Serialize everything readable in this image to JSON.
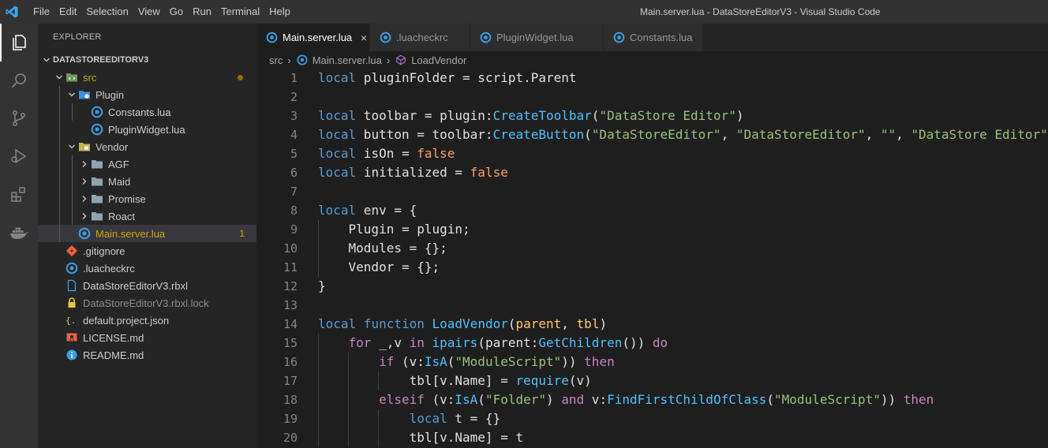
{
  "window": {
    "title": "Main.server.lua - DataStoreEditorV3 - Visual Studio Code"
  },
  "menu": [
    "File",
    "Edit",
    "Selection",
    "View",
    "Go",
    "Run",
    "Terminal",
    "Help"
  ],
  "activity_bar": [
    "explorer-icon",
    "search-icon",
    "source-control-icon",
    "run-debug-icon",
    "extensions-icon",
    "docker-icon"
  ],
  "sidebar": {
    "title": "EXPLORER",
    "section": "DATASTOREEDITORV3",
    "tree": [
      {
        "label": "src",
        "depth": 0,
        "kind": "folder-src",
        "expanded": true,
        "status": "modified"
      },
      {
        "label": "Plugin",
        "depth": 1,
        "kind": "folder-plugin",
        "expanded": true
      },
      {
        "label": "Constants.lua",
        "depth": 2,
        "kind": "lua"
      },
      {
        "label": "PluginWidget.lua",
        "depth": 2,
        "kind": "lua"
      },
      {
        "label": "Vendor",
        "depth": 1,
        "kind": "folder-vendor",
        "expanded": true
      },
      {
        "label": "AGF",
        "depth": 2,
        "kind": "folder",
        "expanded": false
      },
      {
        "label": "Maid",
        "depth": 2,
        "kind": "folder",
        "expanded": false
      },
      {
        "label": "Promise",
        "depth": 2,
        "kind": "folder",
        "expanded": false
      },
      {
        "label": "Roact",
        "depth": 2,
        "kind": "folder",
        "expanded": false
      },
      {
        "label": "Main.server.lua",
        "depth": 1,
        "kind": "lua",
        "selected": true,
        "status": "warning",
        "badge": "1"
      },
      {
        "label": ".gitignore",
        "depth": 0,
        "kind": "git"
      },
      {
        "label": ".luacheckrc",
        "depth": 0,
        "kind": "lua"
      },
      {
        "label": "DataStoreEditorV3.rbxl",
        "depth": 0,
        "kind": "file"
      },
      {
        "label": "DataStoreEditorV3.rbxl.lock",
        "depth": 0,
        "kind": "lock",
        "status": "ignored"
      },
      {
        "label": "default.project.json",
        "depth": 0,
        "kind": "json"
      },
      {
        "label": "LICENSE.md",
        "depth": 0,
        "kind": "license"
      },
      {
        "label": "README.md",
        "depth": 0,
        "kind": "info"
      }
    ]
  },
  "tabs": [
    {
      "label": "Main.server.lua",
      "active": true,
      "close": "×"
    },
    {
      "label": ".luacheckrc",
      "active": false
    },
    {
      "label": "PluginWidget.lua",
      "active": false
    },
    {
      "label": "Constants.lua",
      "active": false
    }
  ],
  "breadcrumb": [
    "src",
    "Main.server.lua",
    "LoadVendor"
  ],
  "colors": {
    "keyword": "#569cd6",
    "function": "#4fc1ff",
    "string": "#98c379",
    "boolean": "#ff9e64",
    "default": "#e0e0e0",
    "parameter": "#ffc66d",
    "control": "#c586c0"
  },
  "code": [
    {
      "n": "1",
      "indent": 0,
      "tokens": [
        [
          "local",
          "kw"
        ],
        [
          " pluginFolder = script.Parent",
          "d"
        ]
      ]
    },
    {
      "n": "2",
      "indent": 0,
      "tokens": []
    },
    {
      "n": "3",
      "indent": 0,
      "tokens": [
        [
          "local",
          "kw"
        ],
        [
          " toolbar = plugin:",
          "d"
        ],
        [
          "CreateToolbar",
          "fn"
        ],
        [
          "(",
          "d"
        ],
        [
          "\"DataStore Editor\"",
          "str"
        ],
        [
          ")",
          "d"
        ]
      ]
    },
    {
      "n": "4",
      "indent": 0,
      "tokens": [
        [
          "local",
          "kw"
        ],
        [
          " button = toolbar:",
          "d"
        ],
        [
          "CreateButton",
          "fn"
        ],
        [
          "(",
          "d"
        ],
        [
          "\"DataStoreEditor\"",
          "str"
        ],
        [
          ", ",
          "d"
        ],
        [
          "\"DataStoreEditor\"",
          "str"
        ],
        [
          ", ",
          "d"
        ],
        [
          "\"\"",
          "str"
        ],
        [
          ", ",
          "d"
        ],
        [
          "\"DataStore Editor\"",
          "str"
        ],
        [
          ")",
          "d"
        ]
      ]
    },
    {
      "n": "5",
      "indent": 0,
      "tokens": [
        [
          "local",
          "kw"
        ],
        [
          " isOn = ",
          "d"
        ],
        [
          "false",
          "bool"
        ]
      ]
    },
    {
      "n": "6",
      "indent": 0,
      "tokens": [
        [
          "local",
          "kw"
        ],
        [
          " initialized = ",
          "d"
        ],
        [
          "false",
          "bool"
        ]
      ]
    },
    {
      "n": "7",
      "indent": 0,
      "tokens": []
    },
    {
      "n": "8",
      "indent": 0,
      "tokens": [
        [
          "local",
          "kw"
        ],
        [
          " env = {",
          "d"
        ]
      ]
    },
    {
      "n": "9",
      "indent": 1,
      "tokens": [
        [
          "    Plugin = plugin;",
          "d"
        ]
      ]
    },
    {
      "n": "10",
      "indent": 1,
      "tokens": [
        [
          "    Modules = {};",
          "d"
        ]
      ]
    },
    {
      "n": "11",
      "indent": 1,
      "tokens": [
        [
          "    Vendor = {};",
          "d"
        ]
      ]
    },
    {
      "n": "12",
      "indent": 0,
      "tokens": [
        [
          "}",
          "d"
        ]
      ]
    },
    {
      "n": "13",
      "indent": 0,
      "tokens": []
    },
    {
      "n": "14",
      "indent": 0,
      "tokens": [
        [
          "local",
          "kw"
        ],
        [
          " ",
          "d"
        ],
        [
          "function",
          "kw"
        ],
        [
          " ",
          "d"
        ],
        [
          "LoadVendor",
          "fn"
        ],
        [
          "(",
          "d"
        ],
        [
          "parent",
          "par"
        ],
        [
          ", ",
          "d"
        ],
        [
          "tbl",
          "par"
        ],
        [
          ")",
          "d"
        ]
      ]
    },
    {
      "n": "15",
      "indent": 1,
      "tokens": [
        [
          "    ",
          "d"
        ],
        [
          "for",
          "ctl"
        ],
        [
          " _,v ",
          "d"
        ],
        [
          "in",
          "ctl"
        ],
        [
          " ",
          "d"
        ],
        [
          "ipairs",
          "fn"
        ],
        [
          "(parent:",
          "d"
        ],
        [
          "GetChildren",
          "fn"
        ],
        [
          "()) ",
          "d"
        ],
        [
          "do",
          "ctl"
        ]
      ]
    },
    {
      "n": "16",
      "indent": 2,
      "tokens": [
        [
          "        ",
          "d"
        ],
        [
          "if",
          "ctl"
        ],
        [
          " (v:",
          "d"
        ],
        [
          "IsA",
          "fn"
        ],
        [
          "(",
          "d"
        ],
        [
          "\"ModuleScript\"",
          "str"
        ],
        [
          ")) ",
          "d"
        ],
        [
          "then",
          "ctl"
        ]
      ]
    },
    {
      "n": "17",
      "indent": 3,
      "tokens": [
        [
          "            tbl[v.Name] = ",
          "d"
        ],
        [
          "require",
          "fn"
        ],
        [
          "(v)",
          "d"
        ]
      ]
    },
    {
      "n": "18",
      "indent": 2,
      "tokens": [
        [
          "        ",
          "d"
        ],
        [
          "elseif",
          "ctl"
        ],
        [
          " (v:",
          "d"
        ],
        [
          "IsA",
          "fn"
        ],
        [
          "(",
          "d"
        ],
        [
          "\"Folder\"",
          "str"
        ],
        [
          ") ",
          "d"
        ],
        [
          "and",
          "ctl"
        ],
        [
          " v:",
          "d"
        ],
        [
          "FindFirstChildOfClass",
          "fn"
        ],
        [
          "(",
          "d"
        ],
        [
          "\"ModuleScript\"",
          "str"
        ],
        [
          ")) ",
          "d"
        ],
        [
          "then",
          "ctl"
        ]
      ]
    },
    {
      "n": "19",
      "indent": 3,
      "tokens": [
        [
          "            ",
          "d"
        ],
        [
          "local",
          "kw"
        ],
        [
          " t = {}",
          "d"
        ]
      ]
    },
    {
      "n": "20",
      "indent": 3,
      "tokens": [
        [
          "            tbl[v.Name] = t",
          "d"
        ]
      ]
    }
  ]
}
